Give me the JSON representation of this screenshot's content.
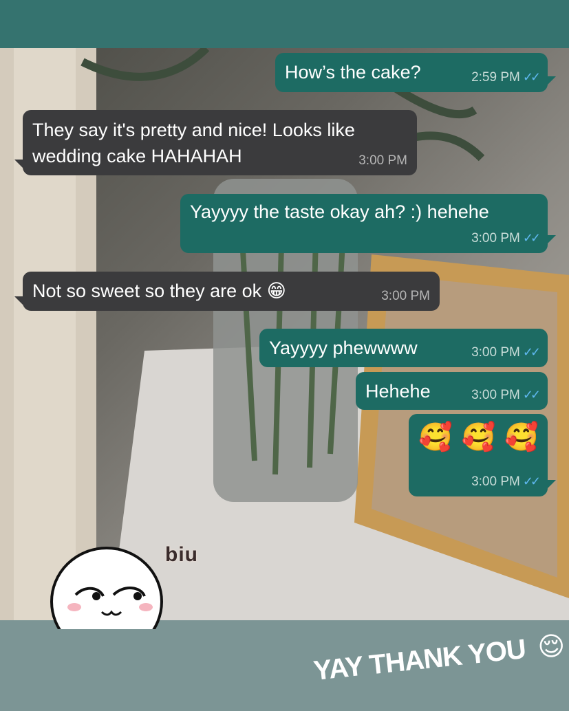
{
  "messages": [
    {
      "dir": "out",
      "text": "How’s the cake?",
      "time": "2:59 PM",
      "status": "read"
    },
    {
      "dir": "in",
      "text_lines": [
        "They say it's pretty and nice! Looks like",
        "wedding cake HAHAHAH"
      ],
      "time": "3:00 PM"
    },
    {
      "dir": "out",
      "text": "Yayyyy the taste okay ah? :) hehehe",
      "time": "3:00 PM",
      "status": "read"
    },
    {
      "dir": "in",
      "text": "Not so sweet so they are ok",
      "emoji": "😁",
      "time": "3:00 PM"
    },
    {
      "dir": "out",
      "text": "Yayyyy phewwww",
      "time": "3:00 PM",
      "status": "read"
    },
    {
      "dir": "out",
      "text": "Hehehe",
      "time": "3:00 PM",
      "status": "read"
    },
    {
      "dir": "out",
      "text": "🥰 🥰 🥰",
      "time": "3:00 PM",
      "status": "read"
    }
  ],
  "read_tick": "✓✓",
  "sticker_text": "biu",
  "story_caption": "YAY THANK YOU",
  "story_caption_emoji": "😌",
  "colors": {
    "outgoing_bubble": "#1d6b63",
    "incoming_bubble": "#3b3b3d",
    "top_bar": "#35736f",
    "bottom_bar": "#7c9595",
    "read_tick": "#5fb8f0"
  }
}
